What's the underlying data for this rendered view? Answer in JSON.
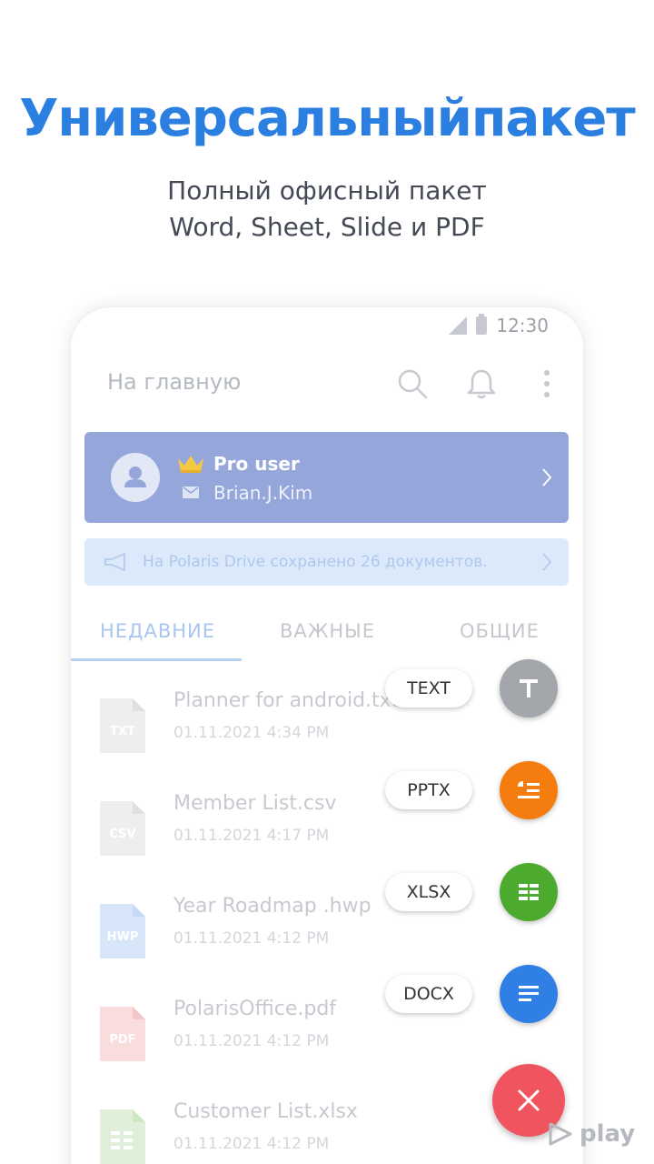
{
  "promo": {
    "headline": "Универсальныйпакет",
    "subtitle_line1": "Полный офисный пакет",
    "subtitle_line2": "Word, Sheet, Slide и PDF"
  },
  "statusbar": {
    "time": "12:30"
  },
  "toolbar": {
    "home_label": "На главную",
    "icons": [
      "search-icon",
      "bell-icon",
      "more-vert-icon"
    ]
  },
  "account": {
    "title": "Pro user",
    "email": "Brian.J.Kim"
  },
  "drive_notice": {
    "text": "На Polaris Drive сохранено 26 документов."
  },
  "tabs": [
    {
      "label": "НЕДАВНИЕ",
      "active": true
    },
    {
      "label": "ВАЖНЫЕ",
      "active": false
    },
    {
      "label": "ОБЩИЕ",
      "active": false
    }
  ],
  "files": [
    {
      "name": "Planner for android.txt",
      "date": "01.11.2021 4:34 PM",
      "type": "TXT",
      "color": "#eeeeee"
    },
    {
      "name": "Member List.csv",
      "date": "01.11.2021 4:17 PM",
      "type": "CSV",
      "color": "#eeeeee"
    },
    {
      "name": "Year Roadmap .hwp",
      "date": "01.11.2021 4:12 PM",
      "type": "HWP",
      "color": "#d7e6f9"
    },
    {
      "name": "PolarisOffice.pdf",
      "date": "01.11.2021 4:12 PM",
      "type": "PDF",
      "color": "#f9dcdc"
    },
    {
      "name": "Customer List.xlsx",
      "date": "01.11.2021 4:12 PM",
      "type": "XLSX",
      "color": "#dfefd9"
    }
  ],
  "fab_menu": [
    {
      "label": "TEXT",
      "color": "#a3a6ab"
    },
    {
      "label": "PPTX",
      "color": "#f57c0f"
    },
    {
      "label": "XLSX",
      "color": "#4caa2e"
    },
    {
      "label": "DOCX",
      "color": "#2f7fe5"
    }
  ],
  "watermark": {
    "text": "play"
  },
  "colors": {
    "headline": "#2a7fe0",
    "pro_card": "#94a6da",
    "fab_close": "#f0545e"
  }
}
